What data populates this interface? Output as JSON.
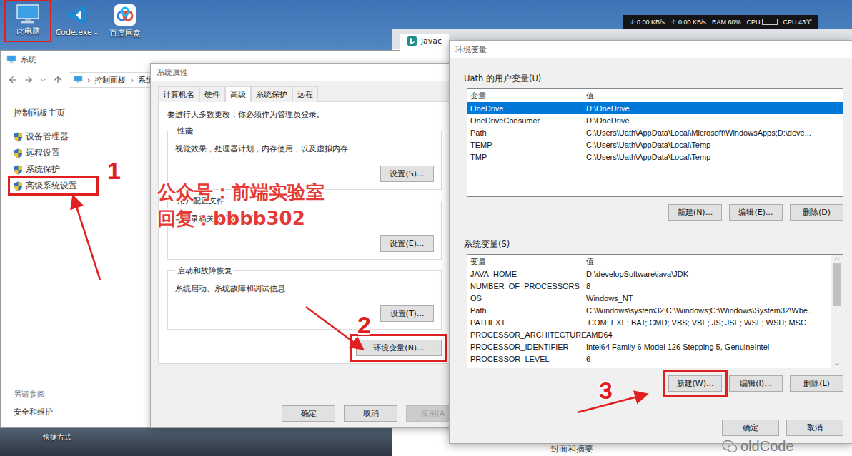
{
  "desktop": {
    "icons": [
      {
        "label": "此电脑",
        "annotated": true
      },
      {
        "label": "Code.exe -",
        "annotated": false
      },
      {
        "label": "百度网盘",
        "annotated": false
      }
    ],
    "shortcut_label": "快捷方式",
    "net_monitor": {
      "down": "0.00 KB/s",
      "up": "0.00 KB/s",
      "ram": "RAM 60%",
      "cpu_label": "CPU",
      "cpu_level": 0.05,
      "cpu_temp": "CPU 43℃"
    },
    "background_page_text": "封面和摘要"
  },
  "browser": {
    "tabs": [
      {
        "label": "javac",
        "selected": true
      }
    ]
  },
  "system_window": {
    "title": "系统",
    "breadcrumb": [
      "控制面板",
      "系统"
    ],
    "separator": "›",
    "sidebar_home": "控制面板主页",
    "sidebar_items": [
      {
        "label": "设备管理器",
        "annotated": false
      },
      {
        "label": "远程设置",
        "annotated": false
      },
      {
        "label": "系统保护",
        "annotated": false
      },
      {
        "label": "高级系统设置",
        "annotated": true
      }
    ],
    "see_also_title": "另请参阅",
    "see_also_items": [
      "安全和维护"
    ]
  },
  "system_properties": {
    "title": "系统属性",
    "tabs": [
      {
        "label": "计算机名",
        "selected": false
      },
      {
        "label": "硬件",
        "selected": false
      },
      {
        "label": "高级",
        "selected": true
      },
      {
        "label": "系统保护",
        "selected": false
      },
      {
        "label": "远程",
        "selected": false
      }
    ],
    "admin_note": "要进行大多数更改，你必须作为管理员登录。",
    "groups": [
      {
        "title": "性能",
        "description": "视觉效果，处理器计划，内存使用，以及虚拟内存",
        "button": "设置(S)..."
      },
      {
        "title": "用户配置文件",
        "description": "与登录相关的桌面设置",
        "button": "设置(E)..."
      },
      {
        "title": "启动和故障恢复",
        "description": "系统启动、系统故障和调试信息",
        "button": "设置(T)..."
      }
    ],
    "env_button": {
      "label": "环境变量(N)...",
      "annotated": true
    },
    "footer_buttons": [
      {
        "label": "确定",
        "disabled": false
      },
      {
        "label": "取消",
        "disabled": false
      },
      {
        "label": "应用(A",
        "disabled": true
      }
    ]
  },
  "environment_variables": {
    "title": "环境变量",
    "user_section": {
      "title": "Uath 的用户变量(U)",
      "columns": [
        "变量",
        "值"
      ],
      "rows": [
        {
          "name": "OneDrive",
          "value": "D:\\OneDrive",
          "selected": true
        },
        {
          "name": "OneDriveConsumer",
          "value": "D:\\OneDrive",
          "selected": false
        },
        {
          "name": "Path",
          "value": "C:\\Users\\Uath\\AppData\\Local\\Microsoft\\WindowsApps;D:\\deve...",
          "selected": false
        },
        {
          "name": "TEMP",
          "value": "C:\\Users\\Uath\\AppData\\Local\\Temp",
          "selected": false
        },
        {
          "name": "TMP",
          "value": "C:\\Users\\Uath\\AppData\\Local\\Temp",
          "selected": false
        }
      ],
      "buttons": [
        {
          "label": "新建(N)...",
          "annotated": false
        },
        {
          "label": "编辑(E)...",
          "annotated": false
        },
        {
          "label": "删除(D)",
          "annotated": false
        }
      ]
    },
    "system_section": {
      "title": "系统变量(S)",
      "columns": [
        "变量",
        "值"
      ],
      "rows": [
        {
          "name": "JAVA_HOME",
          "value": "D:\\developSoftware\\java\\JDK",
          "selected": false
        },
        {
          "name": "NUMBER_OF_PROCESSORS",
          "value": "8",
          "selected": false
        },
        {
          "name": "OS",
          "value": "Windows_NT",
          "selected": false
        },
        {
          "name": "Path",
          "value": "C:\\Windows\\system32;C:\\Windows;C:\\Windows\\System32\\Wbe...",
          "selected": false
        },
        {
          "name": "PATHEXT",
          "value": ".COM;.EXE;.BAT;.CMD;.VBS;.VBE;.JS;.JSE;.WSF;.WSH;.MSC",
          "selected": false
        },
        {
          "name": "PROCESSOR_ARCHITECTURE",
          "value": "AMD64",
          "selected": false
        },
        {
          "name": "PROCESSOR_IDENTIFIER",
          "value": "Intel64 Family 6 Model 126 Stepping 5, GenuineIntel",
          "selected": false
        },
        {
          "name": "PROCESSOR_LEVEL",
          "value": "6",
          "selected": false
        }
      ],
      "scroll_level": 0.45,
      "buttons": [
        {
          "label": "新建(W)...",
          "annotated": true
        },
        {
          "label": "编辑(I)...",
          "annotated": false
        },
        {
          "label": "删除(L)",
          "annotated": false
        }
      ]
    },
    "footer_buttons": [
      "确定",
      "取消"
    ]
  },
  "annotations": {
    "steps": [
      "1",
      "2",
      "3"
    ],
    "watermark_lines": [
      "公众号：前端实验室",
      "回复：bbbb302"
    ],
    "brand": "oldCode"
  }
}
